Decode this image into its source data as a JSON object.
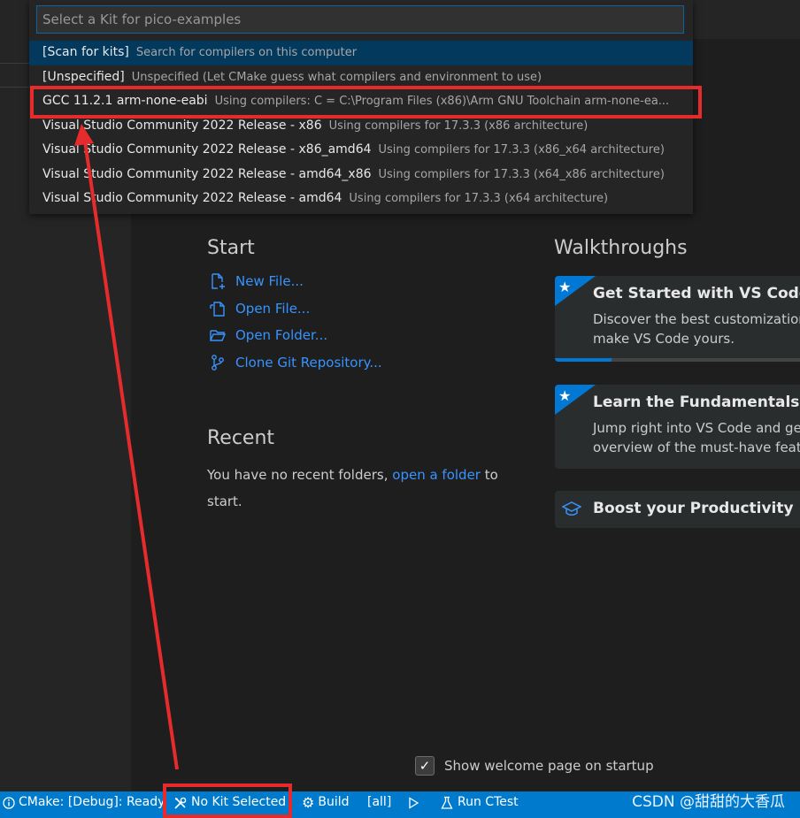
{
  "quickpick": {
    "placeholder": "Select a Kit for pico-examples",
    "items": [
      {
        "label": "[Scan for kits]",
        "description": "Search for compilers on this computer"
      },
      {
        "label": "[Unspecified]",
        "description": "Unspecified (Let CMake guess what compilers and environment to use)"
      },
      {
        "label": "GCC 11.2.1 arm-none-eabi",
        "description": "Using compilers: C = C:\\Program Files (x86)\\Arm GNU Toolchain arm-none-ea..."
      },
      {
        "label": "Visual Studio Community 2022 Release - x86",
        "description": "Using compilers for 17.3.3 (x86 architecture)"
      },
      {
        "label": "Visual Studio Community 2022 Release - x86_amd64",
        "description": "Using compilers for 17.3.3 (x86_x64 architecture)"
      },
      {
        "label": "Visual Studio Community 2022 Release - amd64_x86",
        "description": "Using compilers for 17.3.3 (x64_x86 architecture)"
      },
      {
        "label": "Visual Studio Community 2022 Release - amd64",
        "description": "Using compilers for 17.3.3 (x64 architecture)"
      }
    ]
  },
  "welcome": {
    "start_title": "Start",
    "start_links": [
      {
        "label": "New File...",
        "icon": "new-file-icon"
      },
      {
        "label": "Open File...",
        "icon": "open-file-icon"
      },
      {
        "label": "Open Folder...",
        "icon": "open-folder-icon"
      },
      {
        "label": "Clone Git Repository...",
        "icon": "git-branch-icon"
      }
    ],
    "recent_title": "Recent",
    "recent_prefix": "You have no recent folders,",
    "recent_link": "open a folder",
    "recent_suffix": "to start.",
    "walkthroughs_title": "Walkthroughs",
    "walkthroughs": [
      {
        "title": "Get Started with VS Code",
        "description_line1": "Discover the best customizations",
        "description_line2": "make VS Code yours.",
        "progress": 0.22
      },
      {
        "title": "Learn the Fundamentals",
        "description_line1": "Jump right into VS Code and get",
        "description_line2": "overview of the must-have featu"
      },
      {
        "title": "Boost your Productivity"
      }
    ],
    "show_on_startup_label": "Show welcome page on startup",
    "show_on_startup_checked": true
  },
  "statusbar": {
    "cmake": "CMake: [Debug]: Ready",
    "kit": "No Kit Selected",
    "build": "Build",
    "target": "[all]",
    "run_ctest": "Run CTest",
    "watermark": "CSDN @甜甜的大香瓜"
  },
  "colors": {
    "accent": "#007acc",
    "link": "#3794ff",
    "annotation": "#e52b2b"
  }
}
